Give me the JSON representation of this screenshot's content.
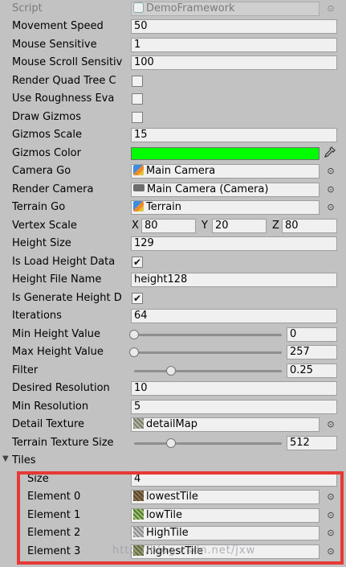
{
  "inspector": {
    "script": {
      "label": "Script",
      "value": "DemoFramework"
    },
    "movement_speed": {
      "label": "Movement Speed",
      "value": "50"
    },
    "mouse_sensitive": {
      "label": "Mouse Sensitive",
      "value": "1"
    },
    "mouse_scroll": {
      "label": "Mouse Scroll Sensitiv",
      "value": "100"
    },
    "render_quad_tree": {
      "label": "Render Quad Tree C",
      "checked": false
    },
    "use_roughness": {
      "label": "Use Roughness Eva",
      "checked": false
    },
    "draw_gizmos": {
      "label": "Draw Gizmos",
      "checked": false
    },
    "gizmos_scale": {
      "label": "Gizmos Scale",
      "value": "15"
    },
    "gizmos_color": {
      "label": "Gizmos Color",
      "color": "#00ff00"
    },
    "camera_go": {
      "label": "Camera Go",
      "value": "Main Camera"
    },
    "render_camera": {
      "label": "Render Camera",
      "value": "Main Camera (Camera)"
    },
    "terrain_go": {
      "label": "Terrain Go",
      "value": "Terrain"
    },
    "vertex_scale": {
      "label": "Vertex Scale",
      "x_label": "X",
      "x": "80",
      "y_label": "Y",
      "y": "20",
      "z_label": "Z",
      "z": "80"
    },
    "height_size": {
      "label": "Height Size",
      "value": "129"
    },
    "is_load_height": {
      "label": "Is Load Height Data",
      "checked": true
    },
    "height_file_name": {
      "label": "Height File Name",
      "value": "height128"
    },
    "is_generate_height": {
      "label": "Is Generate Height D",
      "checked": true
    },
    "iterations": {
      "label": "Iterations",
      "value": "64"
    },
    "min_height": {
      "label": "Min Height Value",
      "value": "0",
      "fraction": 0
    },
    "max_height": {
      "label": "Max Height Value",
      "value": "257",
      "fraction": 0
    },
    "filter": {
      "label": "Filter",
      "value": "0.25",
      "fraction": 0.25
    },
    "desired_resolution": {
      "label": "Desired Resolution",
      "value": "10"
    },
    "min_resolution": {
      "label": "Min Resolution",
      "value": "5"
    },
    "detail_texture": {
      "label": "Detail Texture",
      "value": "detailMap"
    },
    "terrain_texture_size": {
      "label": "Terrain Texture Size",
      "value": "512",
      "fraction": 0.25
    },
    "tiles": {
      "label": "Tiles",
      "size": {
        "label": "Size",
        "value": "4"
      },
      "elements": [
        {
          "label": "Element 0",
          "value": "lowestTile"
        },
        {
          "label": "Element 1",
          "value": "lowTile"
        },
        {
          "label": "Element 2",
          "value": "HighTile"
        },
        {
          "label": "Element 3",
          "value": "highestTile"
        }
      ]
    }
  },
  "watermark": "http://blog.csdn.net/jxw",
  "icons": {
    "object_picker": "target-circle-icon",
    "eyedropper": "eyedropper-icon",
    "foldout": "triangle-down-icon"
  },
  "colors": {
    "highlight_border": "#e53935",
    "panel_bg": "#c2c2c2"
  }
}
